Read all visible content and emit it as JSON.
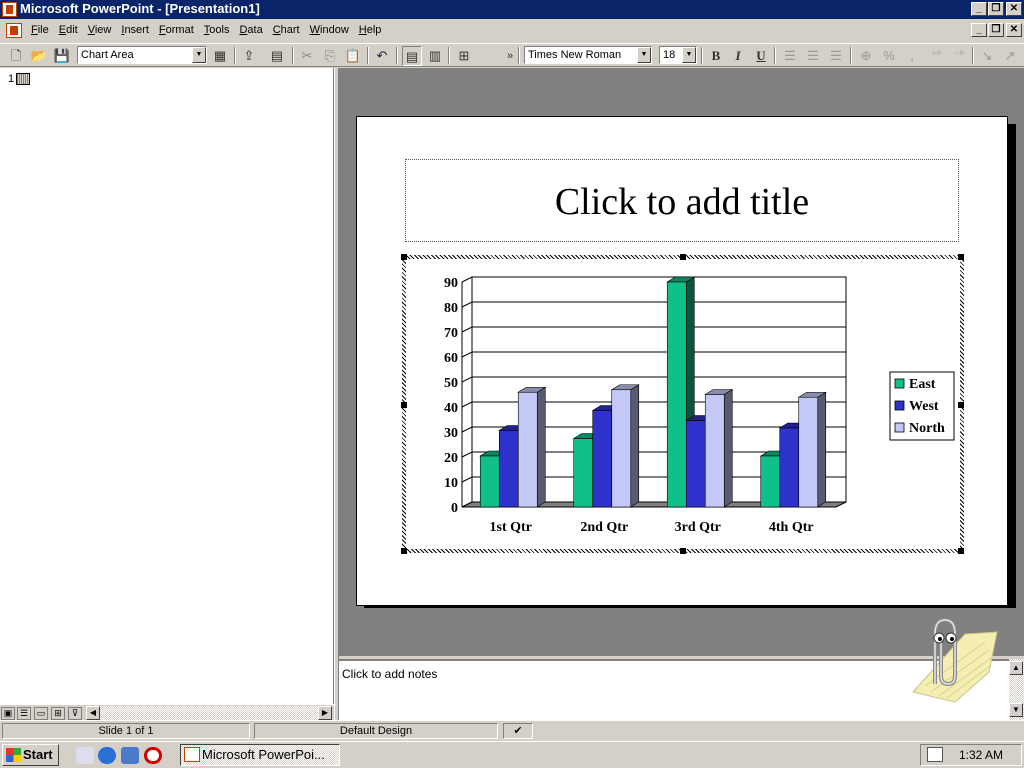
{
  "window": {
    "title": "Microsoft PowerPoint - [Presentation1]"
  },
  "menu": [
    "File",
    "Edit",
    "View",
    "Insert",
    "Format",
    "Tools",
    "Data",
    "Chart",
    "Window",
    "Help"
  ],
  "toolbar": {
    "chart_object_selector": "Chart Area",
    "font_name": "Times New Roman",
    "font_size": "18",
    "bold_label": "B",
    "italic_label": "I",
    "underline_label": "U"
  },
  "outline": {
    "slide_number": "1"
  },
  "slide": {
    "title_placeholder": "Click to add title"
  },
  "chart_data": {
    "type": "bar",
    "style": "3d-clustered-column",
    "categories": [
      "1st Qtr",
      "2nd Qtr",
      "3rd Qtr",
      "4th Qtr"
    ],
    "series": [
      {
        "name": "East",
        "color": "#10c08a",
        "values": [
          20.4,
          27.4,
          90,
          20.4
        ]
      },
      {
        "name": "West",
        "color": "#2e31cc",
        "values": [
          30.6,
          38.6,
          34.6,
          31.6
        ]
      },
      {
        "name": "North",
        "color": "#c4c8f6",
        "values": [
          45.9,
          46.9,
          45,
          43.9
        ]
      }
    ],
    "ylim": [
      0,
      90
    ],
    "yticks": [
      0,
      10,
      20,
      30,
      40,
      50,
      60,
      70,
      80,
      90
    ],
    "grid": true,
    "legend": "right"
  },
  "notes": {
    "placeholder": "Click to add notes"
  },
  "status": {
    "slide_info": "Slide 1 of 1",
    "design": "Default Design"
  },
  "taskbar": {
    "start_label": "Start",
    "task_label": "Microsoft PowerPoi...",
    "clock": "1:32 AM"
  },
  "colors": {
    "titlebar": "#0a246a",
    "face": "#d4d0c8",
    "workspace": "#808080"
  }
}
